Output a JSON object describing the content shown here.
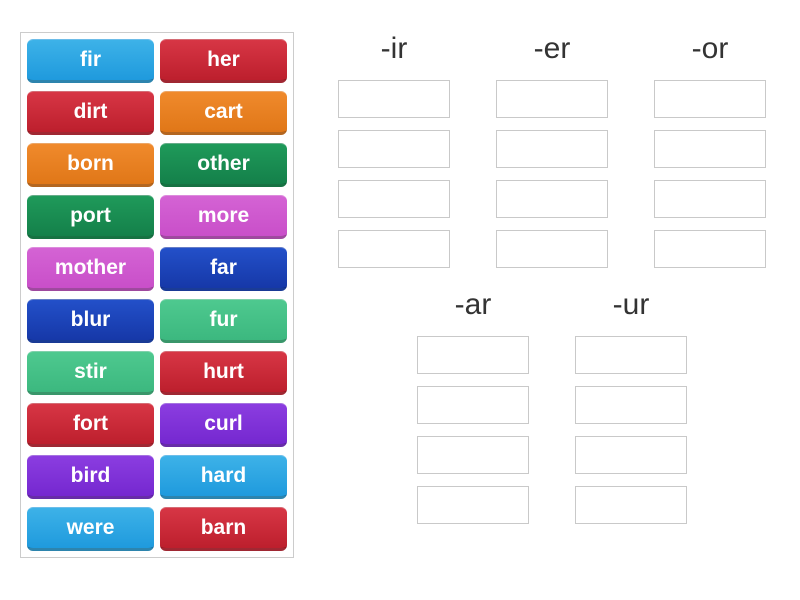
{
  "word_bank": [
    {
      "label": "fir",
      "color": "c-blue"
    },
    {
      "label": "her",
      "color": "c-red"
    },
    {
      "label": "dirt",
      "color": "c-red"
    },
    {
      "label": "cart",
      "color": "c-orange"
    },
    {
      "label": "born",
      "color": "c-orange"
    },
    {
      "label": "other",
      "color": "c-green"
    },
    {
      "label": "port",
      "color": "c-green"
    },
    {
      "label": "more",
      "color": "c-magenta"
    },
    {
      "label": "mother",
      "color": "c-magenta"
    },
    {
      "label": "far",
      "color": "c-navy"
    },
    {
      "label": "blur",
      "color": "c-navy"
    },
    {
      "label": "fur",
      "color": "c-teal"
    },
    {
      "label": "stir",
      "color": "c-teal"
    },
    {
      "label": "hurt",
      "color": "c-red"
    },
    {
      "label": "fort",
      "color": "c-red"
    },
    {
      "label": "curl",
      "color": "c-purple"
    },
    {
      "label": "bird",
      "color": "c-purple"
    },
    {
      "label": "hard",
      "color": "c-blue"
    },
    {
      "label": "were",
      "color": "c-blue"
    },
    {
      "label": "barn",
      "color": "c-red"
    }
  ],
  "categories_rows": [
    [
      {
        "label": "-ir",
        "slots": 4
      },
      {
        "label": "-er",
        "slots": 4
      },
      {
        "label": "-or",
        "slots": 4
      }
    ],
    [
      {
        "label": "-ar",
        "slots": 4
      },
      {
        "label": "-ur",
        "slots": 4
      }
    ]
  ]
}
